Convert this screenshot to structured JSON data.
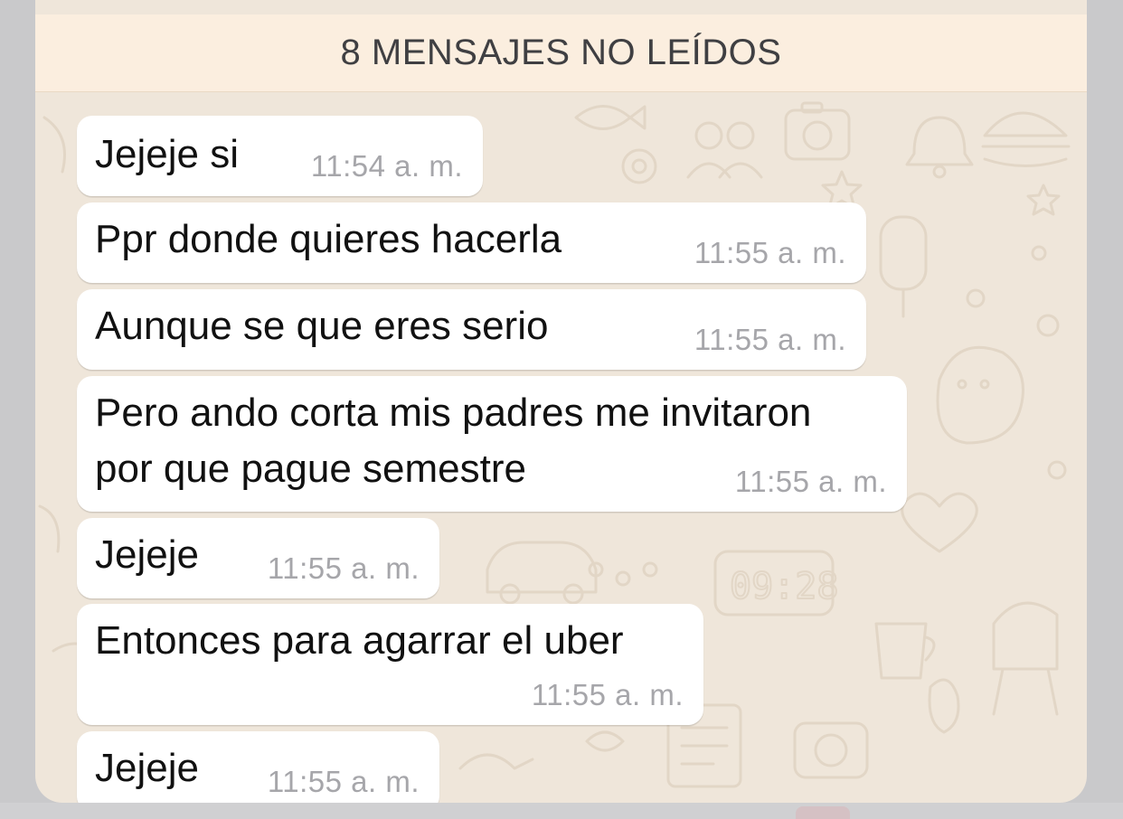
{
  "banner": {
    "unread_label": "8 MENSAJES NO LEÍDOS"
  },
  "messages": [
    {
      "text": "Jejeje si",
      "time": "11:54 a. m."
    },
    {
      "text": "Ppr donde quieres hacerla",
      "time": "11:55 a. m."
    },
    {
      "text": "Aunque se que eres serio",
      "time": "11:55 a. m."
    },
    {
      "text": "Pero ando corta mis padres me invitaron\npor que pague semestre",
      "time": "11:55 a. m."
    },
    {
      "text": "Jejeje",
      "time": "11:55 a. m."
    },
    {
      "text": "Entonces para agarrar el uber",
      "time": "11:55 a. m."
    },
    {
      "text": "Jejeje",
      "time": "11:55 a. m."
    }
  ],
  "colors": {
    "chat_background": "#efe6da",
    "banner_background": "#fbeedf",
    "bubble_background": "#ffffff",
    "timestamp_color": "#a6a6aa"
  },
  "icons": [
    "doodle-wallpaper"
  ]
}
